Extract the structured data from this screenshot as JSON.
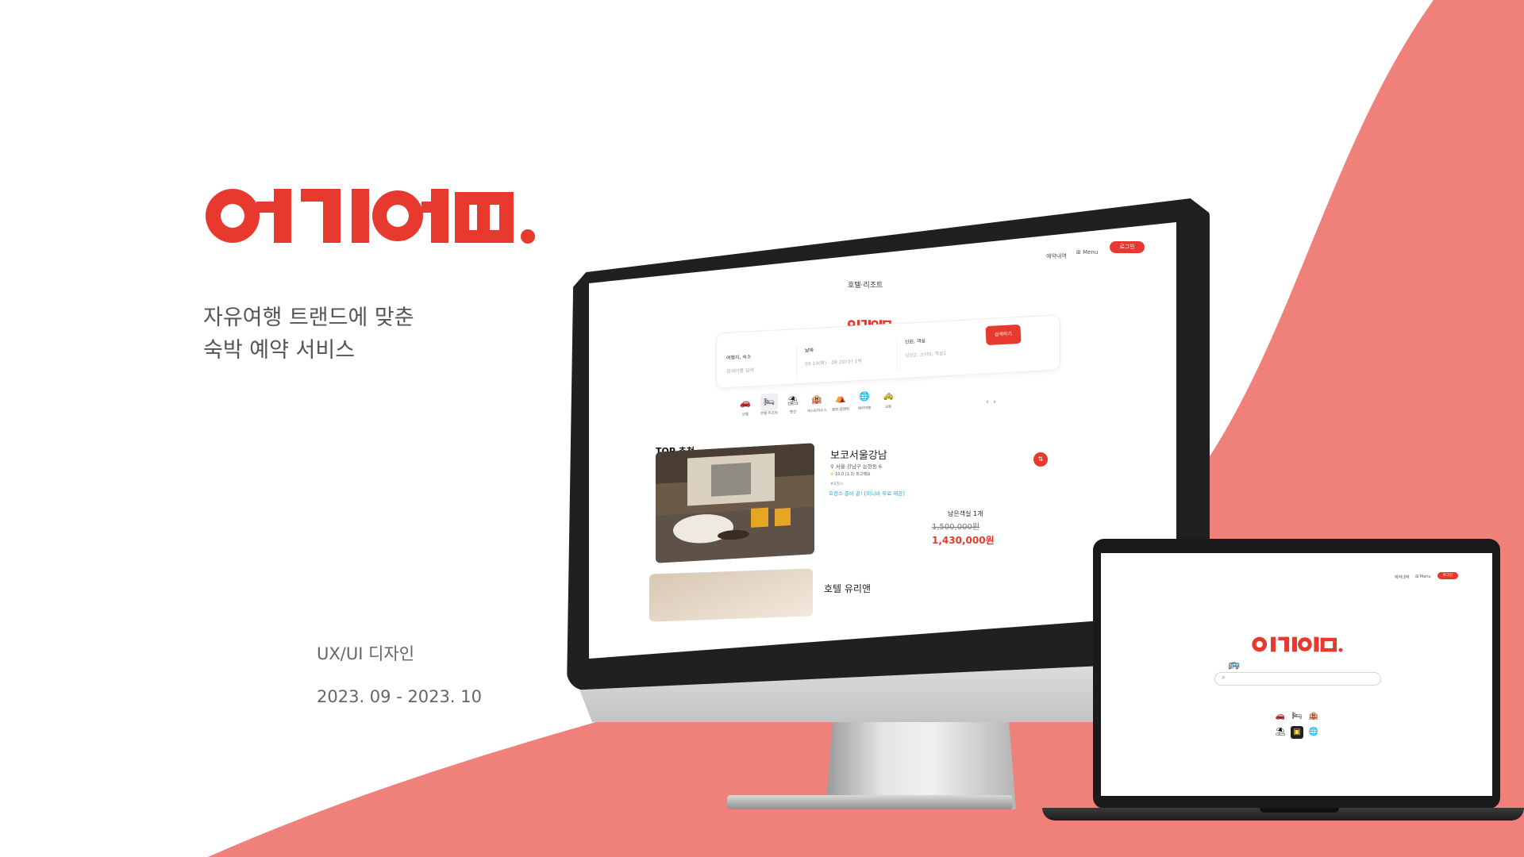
{
  "brand": {
    "logo_text": "여기어때.",
    "color": "#e8392f"
  },
  "intro": {
    "line1": "자유여행 트랜드에 맞춘",
    "line2": "숙박 예약 서비스",
    "project_type": "UX/UI 디자인",
    "period": "2023. 09 - 2023. 10"
  },
  "colors": {
    "accent": "#e8392f",
    "background_shape": "#f0807a"
  },
  "desktop_mockup": {
    "nav": {
      "reservations": "예약내역",
      "menu": "Menu",
      "login": "로그인"
    },
    "category_title": "호텔·리조트",
    "search": {
      "destination_label": "여행지, 숙소",
      "destination_placeholder": "검색어를 입력",
      "date_label": "날짜",
      "date_value": "09.19(화) - 09.20(수) 1박",
      "guests_label": "인원, 객실",
      "guests_value": "성인2, 소아0, 객실1",
      "button": "검색하기"
    },
    "categories": [
      {
        "icon": "car-motel-icon",
        "glyph": "🚗",
        "label": "모텔"
      },
      {
        "icon": "bed-icon",
        "glyph": "🛏",
        "label": "호텔·리조트"
      },
      {
        "icon": "pension-icon",
        "glyph": "⛱",
        "label": "펜션"
      },
      {
        "icon": "building-icon",
        "glyph": "🏨",
        "label": "게스트하우스"
      },
      {
        "icon": "tent-icon",
        "glyph": "⛺",
        "label": "캠핑·글램핑"
      },
      {
        "icon": "globe-icon",
        "glyph": "🌐",
        "label": "해외여행"
      },
      {
        "icon": "taxi-icon",
        "glyph": "🚕",
        "label": "교통"
      }
    ],
    "top_section_title": "TOP 추천",
    "hotel": {
      "name": "보코서울강남",
      "address": "서울 강남구 논현동 6",
      "rating": "10.0 (1.3) 최고예요",
      "tag": "#호캉스",
      "promo": "호캉스 준비 끝! [미니바 무료 제공]",
      "remaining": "남은객실 1개",
      "original_price": "1,500,000원",
      "price": "1,430,000원"
    },
    "hotel2": {
      "name": "호텔 유리앤"
    }
  },
  "laptop_mockup": {
    "nav": {
      "reservations": "예약내역",
      "menu": "Menu",
      "login": "로그인"
    },
    "logo_text": "여기어때.",
    "categories": [
      {
        "icon": "car-motel-icon",
        "glyph": "🚗"
      },
      {
        "icon": "bed-icon",
        "glyph": "🛏"
      },
      {
        "icon": "building-icon",
        "glyph": "🏨"
      },
      {
        "icon": "pension-icon",
        "glyph": "⛱"
      },
      {
        "icon": "sale-badge-icon",
        "glyph": "▣"
      },
      {
        "icon": "globe-icon",
        "glyph": "🌐"
      }
    ]
  }
}
